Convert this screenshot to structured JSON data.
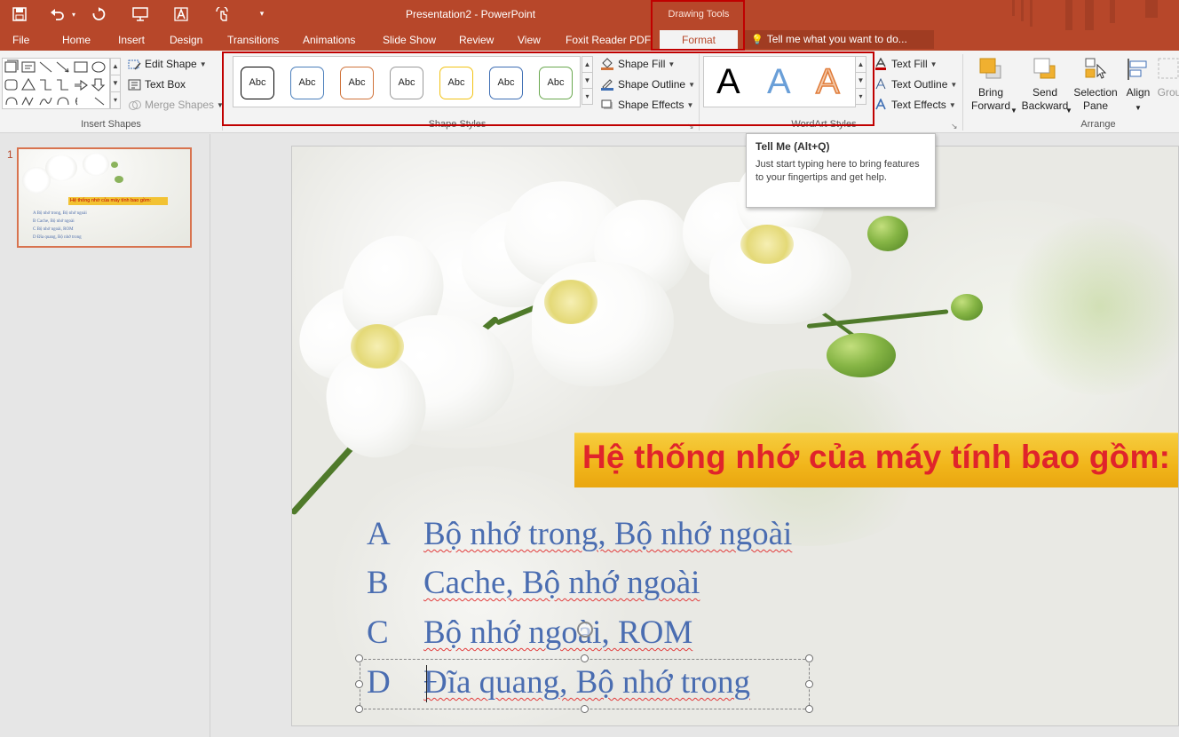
{
  "titlebar": {
    "title": "Presentation2 - PowerPoint",
    "contextual_group": "Drawing Tools",
    "bg_color": "#b7472a",
    "qat": [
      "save-icon",
      "undo-icon",
      "redo-icon",
      "present-icon",
      "text-a-icon",
      "touch-mode-icon",
      "customize-qat-icon"
    ]
  },
  "tabs": {
    "file": "File",
    "home": "Home",
    "insert": "Insert",
    "design": "Design",
    "transitions": "Transitions",
    "animations": "Animations",
    "slide_show": "Slide Show",
    "review": "Review",
    "view": "View",
    "foxit": "Foxit Reader PDF",
    "format": "Format",
    "tell_me": "Tell me what you want to do..."
  },
  "ribbon": {
    "insert_shapes": {
      "label": "Insert Shapes",
      "edit_shape": "Edit Shape",
      "text_box": "Text Box",
      "merge_shapes": "Merge Shapes"
    },
    "shape_styles": {
      "label": "Shape Styles",
      "presets": [
        {
          "text": "Abc",
          "border": "#000000"
        },
        {
          "text": "Abc",
          "border": "#4a7ebb"
        },
        {
          "text": "Abc",
          "border": "#d0743c"
        },
        {
          "text": "Abc",
          "border": "#9a9a9a"
        },
        {
          "text": "Abc",
          "border": "#f2c314"
        },
        {
          "text": "Abc",
          "border": "#3e6eb4"
        },
        {
          "text": "Abc",
          "border": "#6aa84f"
        }
      ],
      "shape_fill": "Shape Fill",
      "shape_outline": "Shape Outline",
      "shape_effects": "Shape Effects"
    },
    "wordart_styles": {
      "label": "WordArt Styles",
      "samples": [
        {
          "text": "A",
          "style": "black"
        },
        {
          "text": "A",
          "style": "blue-gradient"
        },
        {
          "text": "A",
          "style": "orange-outline"
        }
      ],
      "text_fill": "Text Fill",
      "text_outline": "Text Outline",
      "text_effects": "Text Effects"
    },
    "arrange": {
      "label": "Arrange",
      "bring_forward_1": "Bring",
      "bring_forward_2": "Forward",
      "send_backward_1": "Send",
      "send_backward_2": "Backward",
      "selection_pane_1": "Selection",
      "selection_pane_2": "Pane",
      "align": "Align",
      "group": "Grou"
    }
  },
  "tooltip": {
    "title": "Tell Me (Alt+Q)",
    "body": "Just start typing here to bring features to your fingertips and get help."
  },
  "thumbnails": {
    "slide_number": "1",
    "title": "Hệ thống nhớ của máy tính bao gồm:",
    "options": [
      "A   Bộ nhớ trong, Bộ nhớ ngoài",
      "B   Cache, Bộ nhớ ngoài",
      "C   Bộ nhớ ngoài, ROM",
      "D   Đĩa quang, Bộ nhớ trong"
    ]
  },
  "slide": {
    "title": "Hệ thống nhớ của máy tính bao gồm:",
    "options": [
      {
        "letter": "A",
        "text": "Bộ nhớ trong, Bộ nhớ ngoài"
      },
      {
        "letter": "B",
        "text": "Cache, Bộ nhớ ngoài"
      },
      {
        "letter": "C",
        "text": "Bộ nhớ ngoài, ROM"
      },
      {
        "letter": "D",
        "text": "Đĩa quang, Bộ nhớ trong"
      }
    ],
    "title_color": "#e0242b",
    "title_bg": "#f2b81d",
    "option_color": "#4a6db1"
  }
}
